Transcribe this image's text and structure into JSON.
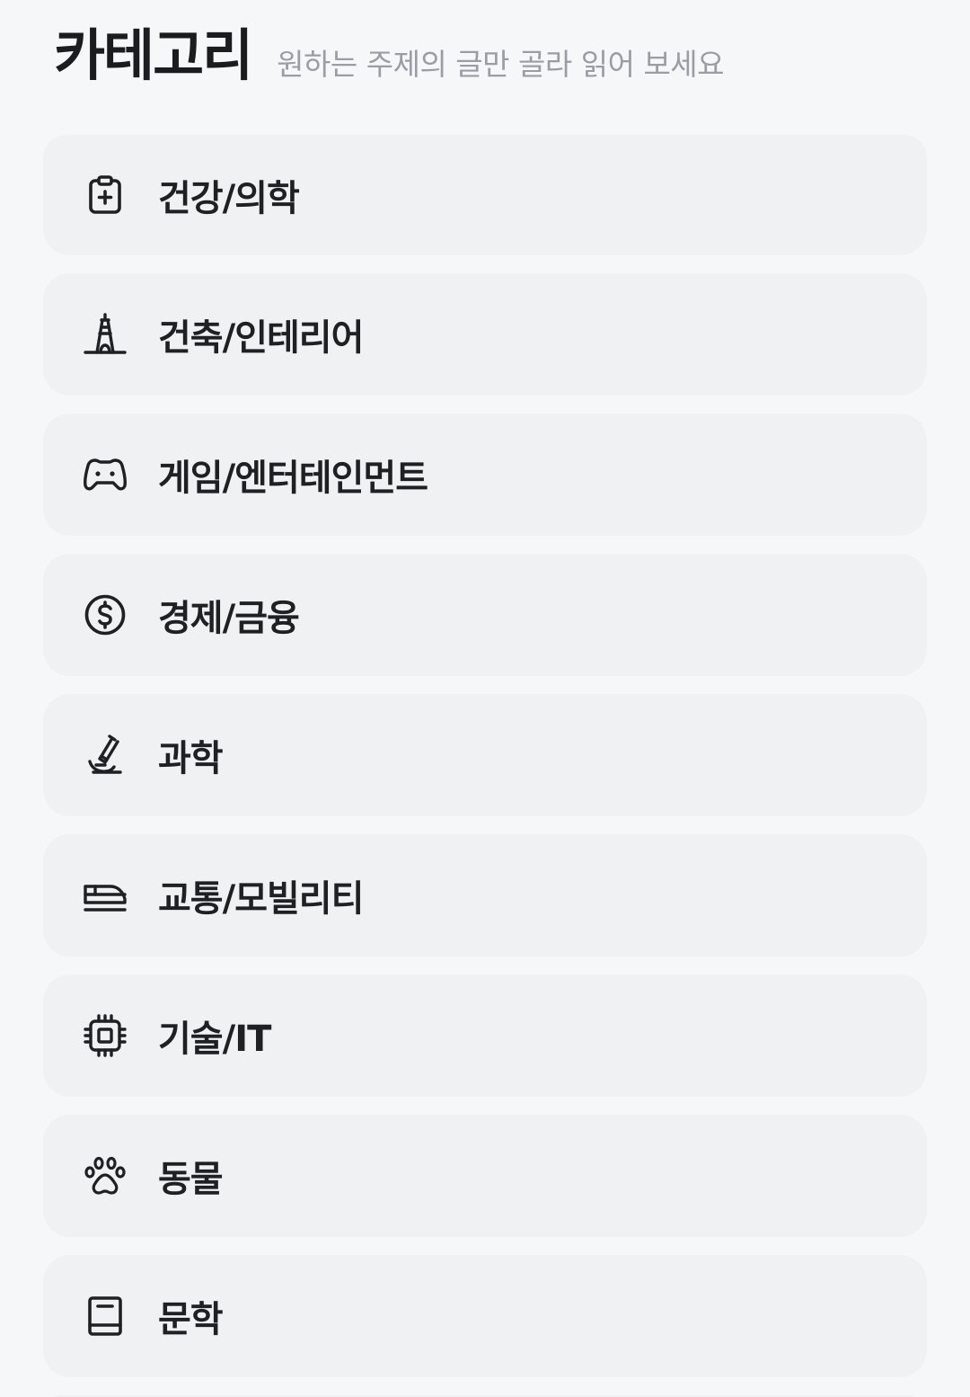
{
  "header": {
    "title": "카테고리",
    "subtitle": "원하는 주제의 글만 골라 읽어 보세요"
  },
  "categories": [
    {
      "label": "건강/의학",
      "icon": "clipboard-plus-icon"
    },
    {
      "label": "건축/인테리어",
      "icon": "tower-icon"
    },
    {
      "label": "게임/엔터테인먼트",
      "icon": "gamepad-icon"
    },
    {
      "label": "경제/금융",
      "icon": "dollar-coin-icon"
    },
    {
      "label": "과학",
      "icon": "microscope-icon"
    },
    {
      "label": "교통/모빌리티",
      "icon": "train-icon"
    },
    {
      "label": "기술/IT",
      "icon": "chip-icon"
    },
    {
      "label": "동물",
      "icon": "paw-icon"
    },
    {
      "label": "문학",
      "icon": "book-icon"
    }
  ]
}
